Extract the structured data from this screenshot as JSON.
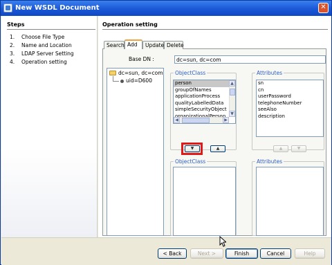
{
  "window": {
    "title": "New WSDL Document"
  },
  "steps": {
    "header": "Steps",
    "items": [
      {
        "num": "1.",
        "label": "Choose File Type"
      },
      {
        "num": "2.",
        "label": "Name and Location"
      },
      {
        "num": "3.",
        "label": "LDAP Server Setting"
      },
      {
        "num": "4.",
        "label": "Operation setting"
      }
    ]
  },
  "main": {
    "header": "Operation setting",
    "tabs": [
      {
        "label": "Search",
        "active": false
      },
      {
        "label": "Add",
        "active": true
      },
      {
        "label": "Update",
        "active": false
      },
      {
        "label": "Delete",
        "active": false
      }
    ],
    "base_dn": {
      "label": "Base DN :",
      "value": "dc=sun, dc=com"
    },
    "tree": {
      "root": "dc=sun, dc=com",
      "child": "uid=D600"
    },
    "top_objectclass": {
      "title": "ObjectClass",
      "items": [
        "person",
        "groupOfNames",
        "applicationProcess",
        "qualityLabelledData",
        "simpleSecurityObject",
        "organizationalPerson"
      ],
      "selected": "person"
    },
    "top_attributes": {
      "title": "Attributes",
      "items": [
        "sn",
        "cn",
        "userPassword",
        "telephoneNumber",
        "seeAlso",
        "description"
      ]
    },
    "bottom_objectclass": {
      "title": "ObjectClass"
    },
    "bottom_attributes": {
      "title": "Attributes"
    }
  },
  "footer": {
    "back": "< Back",
    "next": "Next >",
    "finish": "Finish",
    "cancel": "Cancel",
    "help": "Help"
  }
}
